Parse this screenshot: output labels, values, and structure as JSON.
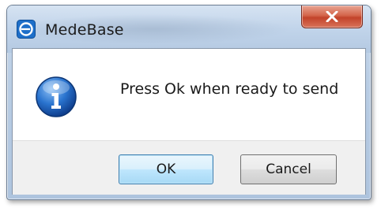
{
  "window": {
    "title": "MedeBase",
    "app_icon": "medebase-app-icon",
    "close_icon": "close-x-icon"
  },
  "dialog": {
    "icon": "info-icon",
    "message": "Press Ok when ready to send"
  },
  "buttons": {
    "ok_label": "OK",
    "cancel_label": "Cancel"
  },
  "colors": {
    "close_button": "#c2432a",
    "info_icon": "#1f5fb5",
    "default_button_border": "#3c7fb1"
  }
}
